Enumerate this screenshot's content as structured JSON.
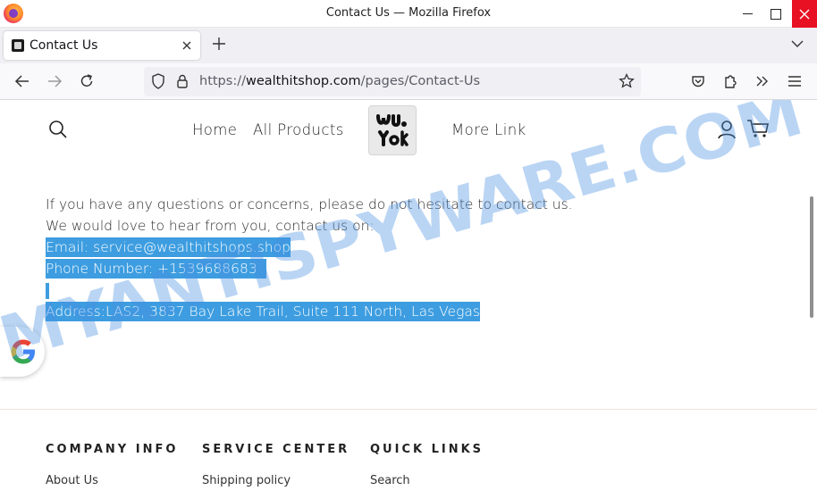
{
  "window": {
    "title": "Contact Us — Mozilla Firefox"
  },
  "tab": {
    "label": "Contact Us"
  },
  "url": {
    "scheme": "https://",
    "domain": "wealthitshop.com",
    "path": "/pages/Contact-Us"
  },
  "site_nav": {
    "home": "Home",
    "all_products": "All Products",
    "more_link": "More Link"
  },
  "logo": {
    "text": "Wu Yak"
  },
  "content": {
    "line1": "If you have any questions or concerns, please do not hesitate to contact us.",
    "line2": "We would love to hear from you, contact us on:",
    "email": "Email: service@wealthitshops.shop",
    "phone": "Phone Number: +1539688683",
    "address": "Address:LAS2, 3837 Bay Lake Trail, Suite 111 North, Las Vegas"
  },
  "footer": {
    "company_info": "COMPANY INFO",
    "service_center": "SERVICE CENTER",
    "quick_links": "QUICK LINKS",
    "about_us": "About Us",
    "shipping_policy": "Shipping policy",
    "search": "Search"
  },
  "watermark": {
    "text": "MYANTISPYWARE.COM"
  },
  "colors": {
    "selection": "#3d9de0",
    "close_button": "#e81123",
    "watermark": "#4a90e2"
  },
  "icons": [
    "firefox-icon",
    "close-icon",
    "plus-icon",
    "chevron-down-icon",
    "back-arrow-icon",
    "forward-arrow-icon",
    "reload-icon",
    "shield-icon",
    "lock-icon",
    "star-icon",
    "pocket-icon",
    "extensions-icon",
    "overflow-icon",
    "menu-icon",
    "search-icon",
    "account-icon",
    "cart-icon",
    "google-icon"
  ]
}
